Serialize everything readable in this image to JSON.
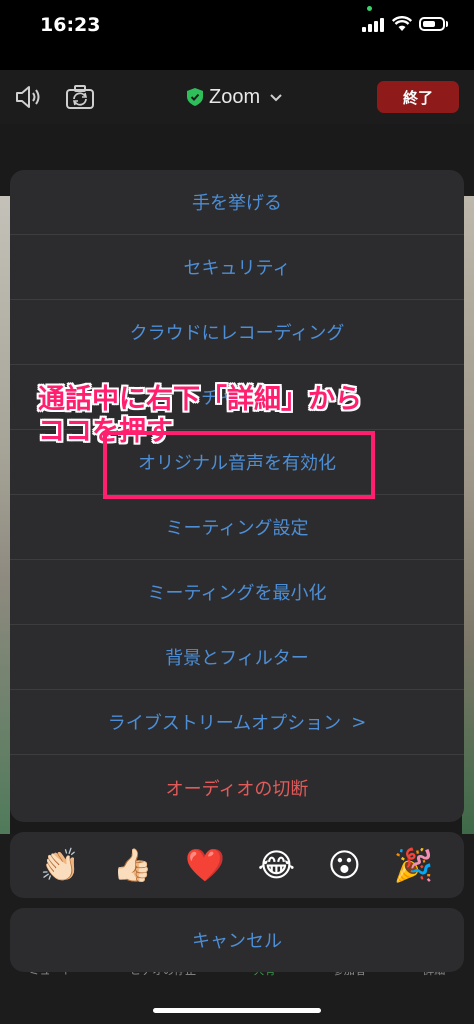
{
  "status_bar": {
    "time": "16:23"
  },
  "top_bar": {
    "meeting_title": "Zoom",
    "end_label": "終了"
  },
  "menu": {
    "items": [
      {
        "label": "手を挙げる"
      },
      {
        "label": "セキュリティ"
      },
      {
        "label": "クラウドにレコーディング"
      },
      {
        "label": "チャット"
      },
      {
        "label": "オリジナル音声を有効化"
      },
      {
        "label": "ミーティング設定"
      },
      {
        "label": "ミーティングを最小化"
      },
      {
        "label": "背景とフィルター"
      },
      {
        "label": "ライブストリームオプション",
        "arrow": ">"
      },
      {
        "label": "オーディオの切断"
      }
    ]
  },
  "reactions": [
    "👏🏻",
    "👍🏻",
    "❤️",
    "😂",
    "😮",
    "🎉"
  ],
  "cancel_label": "キャンセル",
  "bottom_bar": {
    "labels": [
      "ミュート",
      "ビデオの停止",
      "共有",
      "参加者",
      "詳細"
    ]
  },
  "annotation": {
    "line1": "通話中に右下「詳細」から",
    "line2": "ココを押す"
  },
  "colors": {
    "menu_text": "#4d8ed6",
    "danger_text": "#e25a5a",
    "end_button": "#8f1a1a",
    "annotation": "#ff1f6e"
  }
}
